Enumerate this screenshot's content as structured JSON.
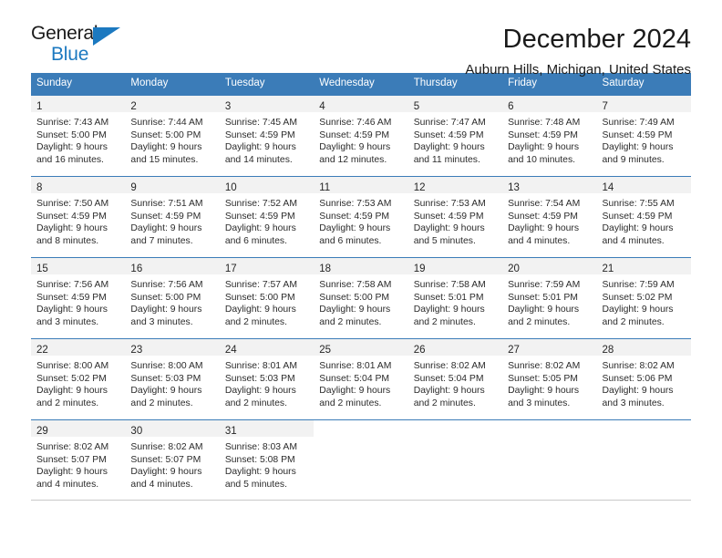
{
  "brand": {
    "name_part1": "General",
    "name_part2": "Blue",
    "flag_icon": "triangle-flag-icon",
    "accent_color": "#1c79c0"
  },
  "header": {
    "title": "December 2024",
    "subtitle": "Auburn Hills, Michigan, United States"
  },
  "theme": {
    "header_bar_color": "#3b7cb8",
    "day_strip_color": "#f2f2f2",
    "text_color": "#2b2b2b"
  },
  "weekdays": [
    "Sunday",
    "Monday",
    "Tuesday",
    "Wednesday",
    "Thursday",
    "Friday",
    "Saturday"
  ],
  "weeks": [
    [
      {
        "day": "1",
        "sunrise": "Sunrise: 7:43 AM",
        "sunset": "Sunset: 5:00 PM",
        "daylight_line1": "Daylight: 9 hours",
        "daylight_line2": "and 16 minutes."
      },
      {
        "day": "2",
        "sunrise": "Sunrise: 7:44 AM",
        "sunset": "Sunset: 5:00 PM",
        "daylight_line1": "Daylight: 9 hours",
        "daylight_line2": "and 15 minutes."
      },
      {
        "day": "3",
        "sunrise": "Sunrise: 7:45 AM",
        "sunset": "Sunset: 4:59 PM",
        "daylight_line1": "Daylight: 9 hours",
        "daylight_line2": "and 14 minutes."
      },
      {
        "day": "4",
        "sunrise": "Sunrise: 7:46 AM",
        "sunset": "Sunset: 4:59 PM",
        "daylight_line1": "Daylight: 9 hours",
        "daylight_line2": "and 12 minutes."
      },
      {
        "day": "5",
        "sunrise": "Sunrise: 7:47 AM",
        "sunset": "Sunset: 4:59 PM",
        "daylight_line1": "Daylight: 9 hours",
        "daylight_line2": "and 11 minutes."
      },
      {
        "day": "6",
        "sunrise": "Sunrise: 7:48 AM",
        "sunset": "Sunset: 4:59 PM",
        "daylight_line1": "Daylight: 9 hours",
        "daylight_line2": "and 10 minutes."
      },
      {
        "day": "7",
        "sunrise": "Sunrise: 7:49 AM",
        "sunset": "Sunset: 4:59 PM",
        "daylight_line1": "Daylight: 9 hours",
        "daylight_line2": "and 9 minutes."
      }
    ],
    [
      {
        "day": "8",
        "sunrise": "Sunrise: 7:50 AM",
        "sunset": "Sunset: 4:59 PM",
        "daylight_line1": "Daylight: 9 hours",
        "daylight_line2": "and 8 minutes."
      },
      {
        "day": "9",
        "sunrise": "Sunrise: 7:51 AM",
        "sunset": "Sunset: 4:59 PM",
        "daylight_line1": "Daylight: 9 hours",
        "daylight_line2": "and 7 minutes."
      },
      {
        "day": "10",
        "sunrise": "Sunrise: 7:52 AM",
        "sunset": "Sunset: 4:59 PM",
        "daylight_line1": "Daylight: 9 hours",
        "daylight_line2": "and 6 minutes."
      },
      {
        "day": "11",
        "sunrise": "Sunrise: 7:53 AM",
        "sunset": "Sunset: 4:59 PM",
        "daylight_line1": "Daylight: 9 hours",
        "daylight_line2": "and 6 minutes."
      },
      {
        "day": "12",
        "sunrise": "Sunrise: 7:53 AM",
        "sunset": "Sunset: 4:59 PM",
        "daylight_line1": "Daylight: 9 hours",
        "daylight_line2": "and 5 minutes."
      },
      {
        "day": "13",
        "sunrise": "Sunrise: 7:54 AM",
        "sunset": "Sunset: 4:59 PM",
        "daylight_line1": "Daylight: 9 hours",
        "daylight_line2": "and 4 minutes."
      },
      {
        "day": "14",
        "sunrise": "Sunrise: 7:55 AM",
        "sunset": "Sunset: 4:59 PM",
        "daylight_line1": "Daylight: 9 hours",
        "daylight_line2": "and 4 minutes."
      }
    ],
    [
      {
        "day": "15",
        "sunrise": "Sunrise: 7:56 AM",
        "sunset": "Sunset: 4:59 PM",
        "daylight_line1": "Daylight: 9 hours",
        "daylight_line2": "and 3 minutes."
      },
      {
        "day": "16",
        "sunrise": "Sunrise: 7:56 AM",
        "sunset": "Sunset: 5:00 PM",
        "daylight_line1": "Daylight: 9 hours",
        "daylight_line2": "and 3 minutes."
      },
      {
        "day": "17",
        "sunrise": "Sunrise: 7:57 AM",
        "sunset": "Sunset: 5:00 PM",
        "daylight_line1": "Daylight: 9 hours",
        "daylight_line2": "and 2 minutes."
      },
      {
        "day": "18",
        "sunrise": "Sunrise: 7:58 AM",
        "sunset": "Sunset: 5:00 PM",
        "daylight_line1": "Daylight: 9 hours",
        "daylight_line2": "and 2 minutes."
      },
      {
        "day": "19",
        "sunrise": "Sunrise: 7:58 AM",
        "sunset": "Sunset: 5:01 PM",
        "daylight_line1": "Daylight: 9 hours",
        "daylight_line2": "and 2 minutes."
      },
      {
        "day": "20",
        "sunrise": "Sunrise: 7:59 AM",
        "sunset": "Sunset: 5:01 PM",
        "daylight_line1": "Daylight: 9 hours",
        "daylight_line2": "and 2 minutes."
      },
      {
        "day": "21",
        "sunrise": "Sunrise: 7:59 AM",
        "sunset": "Sunset: 5:02 PM",
        "daylight_line1": "Daylight: 9 hours",
        "daylight_line2": "and 2 minutes."
      }
    ],
    [
      {
        "day": "22",
        "sunrise": "Sunrise: 8:00 AM",
        "sunset": "Sunset: 5:02 PM",
        "daylight_line1": "Daylight: 9 hours",
        "daylight_line2": "and 2 minutes."
      },
      {
        "day": "23",
        "sunrise": "Sunrise: 8:00 AM",
        "sunset": "Sunset: 5:03 PM",
        "daylight_line1": "Daylight: 9 hours",
        "daylight_line2": "and 2 minutes."
      },
      {
        "day": "24",
        "sunrise": "Sunrise: 8:01 AM",
        "sunset": "Sunset: 5:03 PM",
        "daylight_line1": "Daylight: 9 hours",
        "daylight_line2": "and 2 minutes."
      },
      {
        "day": "25",
        "sunrise": "Sunrise: 8:01 AM",
        "sunset": "Sunset: 5:04 PM",
        "daylight_line1": "Daylight: 9 hours",
        "daylight_line2": "and 2 minutes."
      },
      {
        "day": "26",
        "sunrise": "Sunrise: 8:02 AM",
        "sunset": "Sunset: 5:04 PM",
        "daylight_line1": "Daylight: 9 hours",
        "daylight_line2": "and 2 minutes."
      },
      {
        "day": "27",
        "sunrise": "Sunrise: 8:02 AM",
        "sunset": "Sunset: 5:05 PM",
        "daylight_line1": "Daylight: 9 hours",
        "daylight_line2": "and 3 minutes."
      },
      {
        "day": "28",
        "sunrise": "Sunrise: 8:02 AM",
        "sunset": "Sunset: 5:06 PM",
        "daylight_line1": "Daylight: 9 hours",
        "daylight_line2": "and 3 minutes."
      }
    ],
    [
      {
        "day": "29",
        "sunrise": "Sunrise: 8:02 AM",
        "sunset": "Sunset: 5:07 PM",
        "daylight_line1": "Daylight: 9 hours",
        "daylight_line2": "and 4 minutes."
      },
      {
        "day": "30",
        "sunrise": "Sunrise: 8:02 AM",
        "sunset": "Sunset: 5:07 PM",
        "daylight_line1": "Daylight: 9 hours",
        "daylight_line2": "and 4 minutes."
      },
      {
        "day": "31",
        "sunrise": "Sunrise: 8:03 AM",
        "sunset": "Sunset: 5:08 PM",
        "daylight_line1": "Daylight: 9 hours",
        "daylight_line2": "and 5 minutes."
      },
      {
        "day": "",
        "sunrise": "",
        "sunset": "",
        "daylight_line1": "",
        "daylight_line2": ""
      },
      {
        "day": "",
        "sunrise": "",
        "sunset": "",
        "daylight_line1": "",
        "daylight_line2": ""
      },
      {
        "day": "",
        "sunrise": "",
        "sunset": "",
        "daylight_line1": "",
        "daylight_line2": ""
      },
      {
        "day": "",
        "sunrise": "",
        "sunset": "",
        "daylight_line1": "",
        "daylight_line2": ""
      }
    ]
  ]
}
